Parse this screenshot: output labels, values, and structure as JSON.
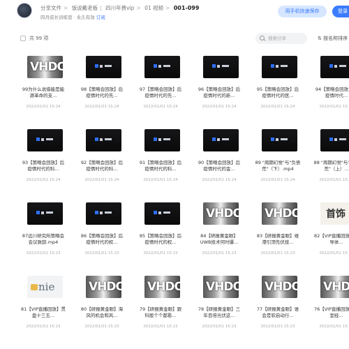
{
  "header": {
    "breadcrumbs": [
      "分享文件",
      "饭说戴老板",
      "四川年费vip",
      "01 视频"
    ],
    "current_folder": "001-099",
    "sharer": "四月成长训练营 · 永久有效",
    "action_link": "订阅",
    "save_button": "用手机快速保存",
    "login_button": "登录"
  },
  "toolbar": {
    "count": "共 99 项",
    "search_placeholder": "搜索分享",
    "sort_label": "按名称排序"
  },
  "files": [
    {
      "title": "99为什么说借能是能源革命的支...",
      "date": "2022/01/01 15:24",
      "thumb": "logo"
    },
    {
      "title": "98【策略会回放】后疫情时代的先...",
      "date": "2022/01/01 15:24",
      "thumb": "dark"
    },
    {
      "title": "97【策略会回放】后疫情时代的先...",
      "date": "2022/01/01 15:24",
      "thumb": "dark"
    },
    {
      "title": "96【策略会回放】后疫情时代的新...",
      "date": "2022/01/01 15:24",
      "thumb": "dark"
    },
    {
      "title": "95【策略会回放】后疫情时代的医...",
      "date": "2022/01/01 15:24",
      "thumb": "dark"
    },
    {
      "title": "94【策略会回放】后疫情时代...",
      "date": "2022/01/01 15:24",
      "thumb": "dark"
    },
    {
      "title": "93【策略会回放】后疫情时代的科...",
      "date": "2022/01/01 15:24",
      "thumb": "dark"
    },
    {
      "title": "92【策略会回放】后疫情时代的科...",
      "date": "2022/01/01 15:24",
      "thumb": "dark"
    },
    {
      "title": "91【策略会回放】后疫情时代的科...",
      "date": "2022/01/01 15:24",
      "thumb": "dark"
    },
    {
      "title": "90【策略会回放】后疫情时代的金...",
      "date": "2022/01/01 15:24",
      "thumb": "dark"
    },
    {
      "title": "89 \"周期幻觉\"与\"负债荒\"（下）.mp4",
      "date": "2022/01/01 15:24",
      "thumb": "dark"
    },
    {
      "title": "88 \"周期幻觉\"与\"负债荒\"（上）...",
      "date": "2022/01/01 15:24",
      "thumb": "dark"
    },
    {
      "title": "87远川研究所策略会 会议致辞.mp4",
      "date": "2022/01/01 15:23",
      "thumb": "dark"
    },
    {
      "title": "86【策略会回放】后疫情时代的权...",
      "date": "2022/01/01 15:23",
      "thumb": "dark"
    },
    {
      "title": "85【策略会回放】后疫情时代的权...",
      "date": "2022/01/01 15:23",
      "thumb": "dark"
    },
    {
      "title": "84【研报黄金眼】UWB技术何时爆...",
      "date": "2022/01/01 15:23",
      "thumb": "logo"
    },
    {
      "title": "83【研报黄金眼】维港引顶先伏技...",
      "date": "2022/01/01 15:23",
      "thumb": "logo"
    },
    {
      "title": "82【VIP直播回放】半导体...",
      "date": "2022/01/01 15:23",
      "thumb": "paper"
    },
    {
      "title": "81【VIP直播回放】贯盘十三五...",
      "date": "2022/01/01 15:23",
      "thumb": "light"
    },
    {
      "title": "80【研报黄金眼】海风的机会和风...",
      "date": "2022/01/01 15:23",
      "thumb": "logo"
    },
    {
      "title": "79【研报黄金眼】跟科股个个都看...",
      "date": "2022/01/01 15:23",
      "thumb": "logo"
    },
    {
      "title": "78【研报黄金眼】三年百倍光伏这...",
      "date": "2022/01/01 15:23",
      "thumb": "logo"
    },
    {
      "title": "77【研报黄金眼】谁会是软启动行...",
      "date": "2022/01/01 15:23",
      "thumb": "logo"
    },
    {
      "title": "76【VIP直播回放】辟室经...",
      "date": "2022/01/01 15:23",
      "thumb": "logo"
    }
  ]
}
